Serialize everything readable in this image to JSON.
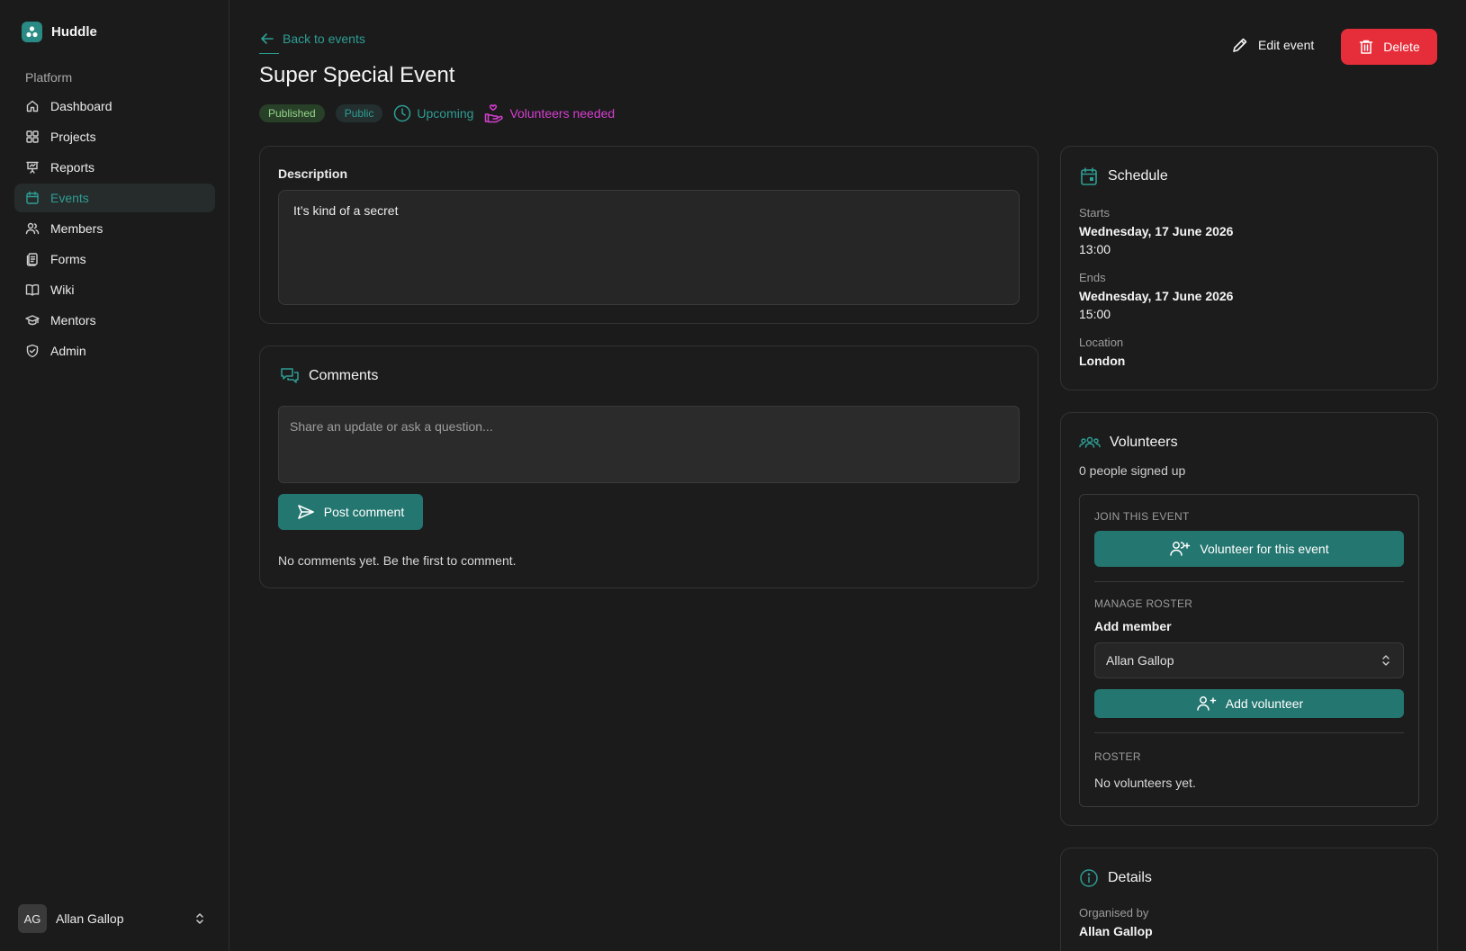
{
  "brand": {
    "name": "Huddle"
  },
  "sidebar": {
    "section_label": "Platform",
    "items": [
      {
        "label": "Dashboard",
        "icon": "home-icon"
      },
      {
        "label": "Projects",
        "icon": "grid-icon"
      },
      {
        "label": "Reports",
        "icon": "presentation-icon"
      },
      {
        "label": "Events",
        "icon": "calendar-icon",
        "active": true
      },
      {
        "label": "Members",
        "icon": "users-icon"
      },
      {
        "label": "Forms",
        "icon": "forms-icon"
      },
      {
        "label": "Wiki",
        "icon": "book-icon"
      },
      {
        "label": "Mentors",
        "icon": "graduation-cap-icon"
      },
      {
        "label": "Admin",
        "icon": "shield-icon"
      }
    ],
    "user": {
      "initials": "AG",
      "name": "Allan Gallop"
    }
  },
  "header": {
    "back_label": "Back to events",
    "title": "Super Special Event",
    "edit_label": "Edit event",
    "delete_label": "Delete",
    "tags": {
      "published": "Published",
      "public": "Public",
      "upcoming": "Upcoming",
      "volunteers_needed": "Volunteers needed"
    }
  },
  "description": {
    "label": "Description",
    "text": "It’s kind of a secret"
  },
  "comments": {
    "title": "Comments",
    "placeholder": "Share an update or ask a question...",
    "post_label": "Post comment",
    "empty_text": "No comments yet. Be the first to comment."
  },
  "schedule": {
    "title": "Schedule",
    "starts_label": "Starts",
    "starts_date": "Wednesday, 17 June 2026",
    "starts_time": "13:00",
    "ends_label": "Ends",
    "ends_date": "Wednesday, 17 June 2026",
    "ends_time": "15:00",
    "location_label": "Location",
    "location": "London"
  },
  "volunteers": {
    "title": "Volunteers",
    "count_text": "0 people signed up",
    "join_heading": "JOIN THIS EVENT",
    "volunteer_label": "Volunteer for this event",
    "manage_heading": "MANAGE ROSTER",
    "add_member_label": "Add member",
    "selected_member": "Allan Gallop",
    "add_label": "Add volunteer",
    "roster_heading": "ROSTER",
    "roster_empty": "No volunteers yet."
  },
  "details": {
    "title": "Details",
    "organised_label": "Organised by",
    "organiser": "Allan Gallop"
  },
  "colors": {
    "accent": "#2e9d94",
    "button_teal": "#247670",
    "danger": "#e62d3a",
    "magenta": "#d63fd1",
    "published_green": "#93d48a",
    "background": "#1b1b1b"
  }
}
